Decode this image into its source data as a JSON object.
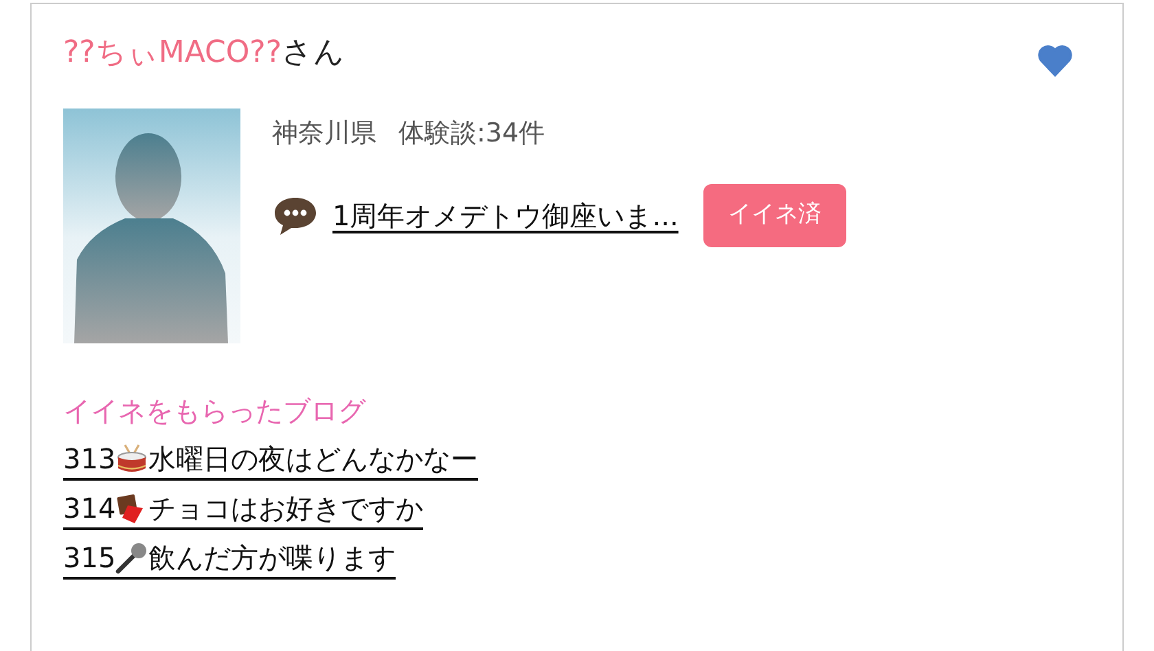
{
  "user": {
    "name": "??ちぃMACO??",
    "honorific": "さん",
    "favorited": true
  },
  "profile": {
    "prefecture": "神奈川県",
    "reviews": "体験談:34件"
  },
  "latest_post": {
    "title": "1周年オメデトウ御座いま...",
    "like_button": {
      "label": "イイネ済",
      "liked": true
    }
  },
  "liked_blogs": {
    "heading": "イイネをもらったブログ",
    "items": [
      {
        "number": "313",
        "kind": "drum",
        "title": "水曜日の夜はどんなかなー"
      },
      {
        "number": "314",
        "kind": "chocolate",
        "title": "チョコはお好きですか"
      },
      {
        "number": "315",
        "kind": "microphone",
        "title": "飲んだ方が喋ります"
      }
    ]
  }
}
